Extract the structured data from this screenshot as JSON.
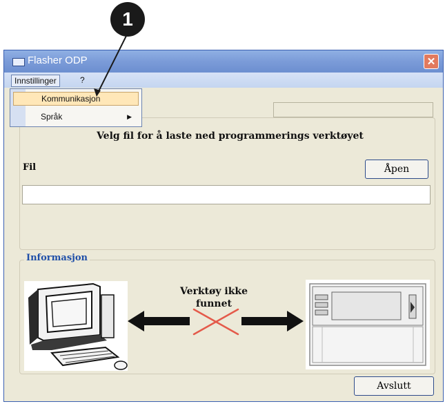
{
  "callout": {
    "number": "1"
  },
  "window": {
    "title": "Flasher ODP",
    "close_symbol": "✕"
  },
  "menubar": {
    "items": [
      {
        "label": "Innstillinger"
      },
      {
        "label": "?"
      }
    ]
  },
  "dropdown": {
    "items": [
      {
        "label": "Kommunikasjon",
        "highlighted": true
      },
      {
        "label": "Språk",
        "has_submenu": true
      }
    ],
    "submenu_arrow": "▶"
  },
  "main": {
    "instruction": "Velg fil for å laste ned programmerings verktøyet",
    "file_label": "Fil",
    "open_button": "Åpen",
    "file_value": ""
  },
  "info": {
    "title": "Informasjon",
    "status_line1": "Verktøy ikke",
    "status_line2": "funnet"
  },
  "footer": {
    "exit_button": "Avslutt"
  },
  "colors": {
    "title_bar": "#7b9bd8",
    "info_title": "#1f4fa8",
    "cross": "#e45a4a",
    "close_button": "#e27a5e"
  }
}
